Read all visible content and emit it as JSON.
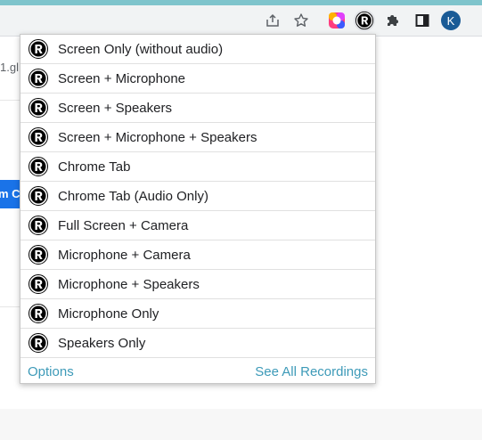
{
  "toolbar": {
    "icons": [
      "share-icon",
      "star-icon",
      "color-extension-icon",
      "recorder-extension-icon",
      "extensions-puzzle-icon",
      "side-panel-icon"
    ],
    "avatar_letter": "K",
    "colors": {
      "accent_strip": "#7fc4cc",
      "avatar": "#1a5b96"
    }
  },
  "page": {
    "url_fragment": "1.gl",
    "button_fragment": "m C"
  },
  "menu": {
    "items": [
      {
        "label": "Screen Only (without audio)"
      },
      {
        "label": "Screen + Microphone"
      },
      {
        "label": "Screen + Speakers"
      },
      {
        "label": "Screen + Microphone + Speakers"
      },
      {
        "label": "Chrome Tab"
      },
      {
        "label": "Chrome Tab (Audio Only)"
      },
      {
        "label": "Full Screen + Camera"
      },
      {
        "label": "Microphone + Camera"
      },
      {
        "label": "Microphone + Speakers"
      },
      {
        "label": "Microphone Only"
      },
      {
        "label": "Speakers Only"
      }
    ],
    "item_icon": "recorder-logo-icon",
    "footer": {
      "options_label": "Options",
      "see_all_label": "See All Recordings",
      "link_color": "#3d9ab8"
    }
  }
}
